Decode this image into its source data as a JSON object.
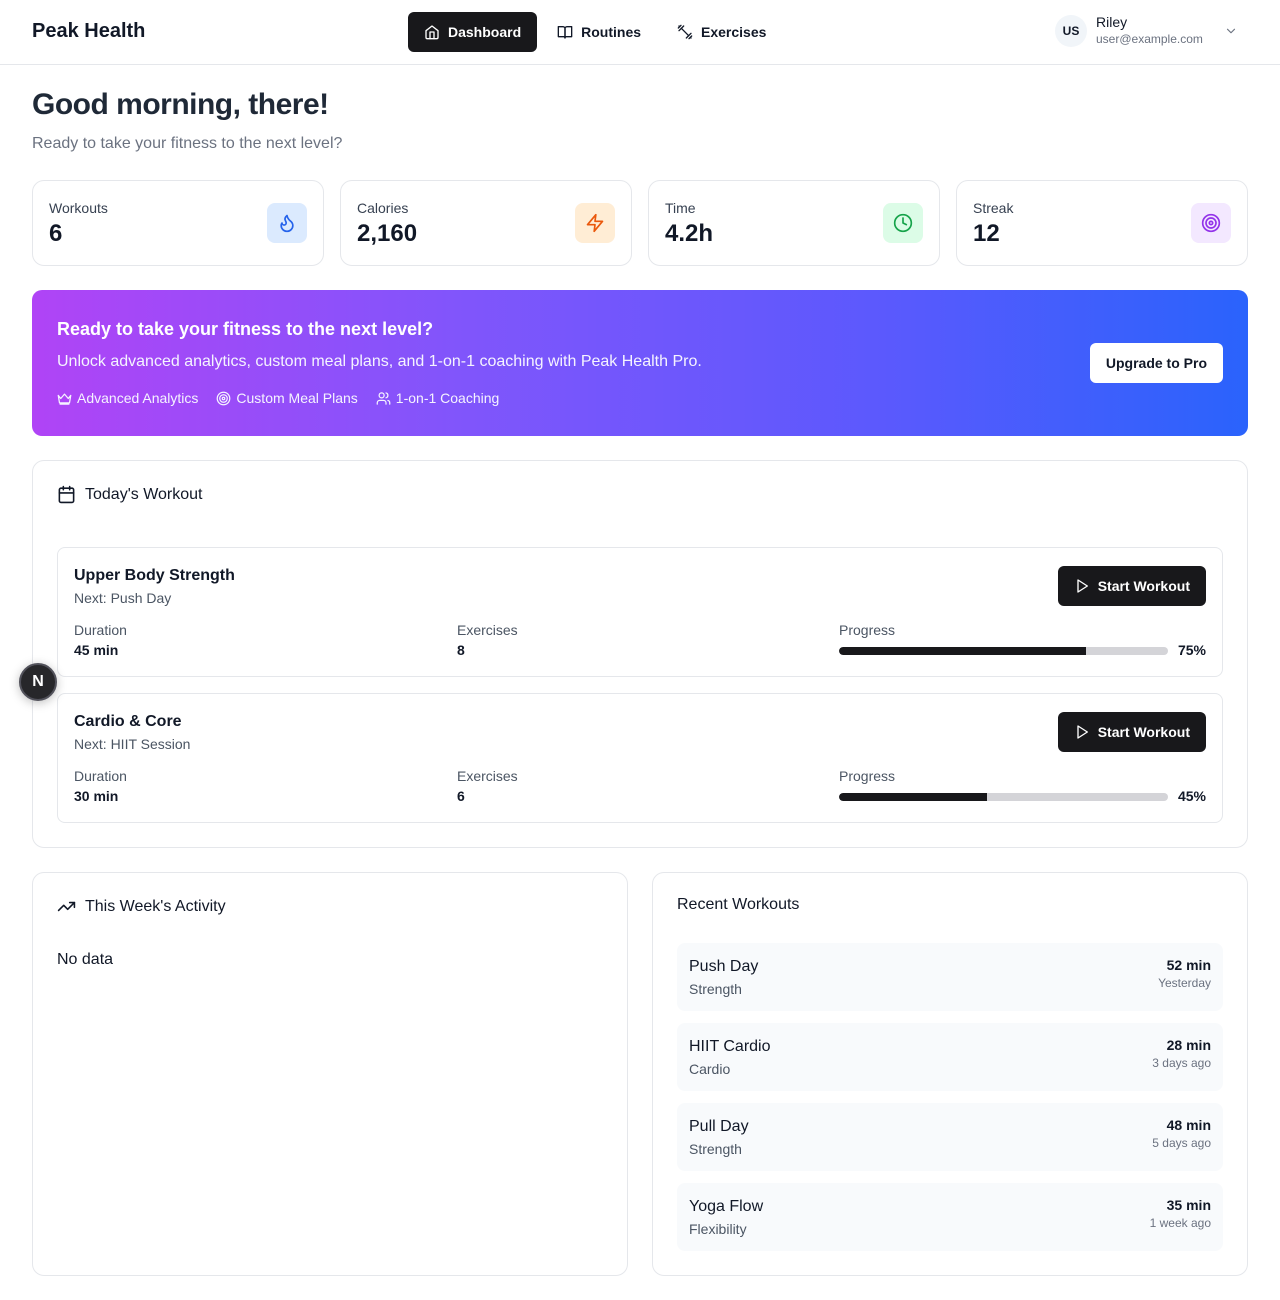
{
  "brand": "Peak Health",
  "nav": [
    {
      "label": "Dashboard",
      "icon": "home-icon",
      "active": true
    },
    {
      "label": "Routines",
      "icon": "book-icon",
      "active": false
    },
    {
      "label": "Exercises",
      "icon": "dumbbell-icon",
      "active": false
    }
  ],
  "user": {
    "initials": "US",
    "name": "Riley",
    "email": "user@example.com"
  },
  "greeting": {
    "title": "Good morning, there!",
    "subtitle": "Ready to take your fitness to the next level?"
  },
  "stats": [
    {
      "label": "Workouts",
      "value": "6",
      "icon": "flame-icon",
      "color": "#2563eb",
      "bg": "#dbeafe"
    },
    {
      "label": "Calories",
      "value": "2,160",
      "icon": "zap-icon",
      "color": "#ea580c",
      "bg": "#ffedd5"
    },
    {
      "label": "Time",
      "value": "4.2h",
      "icon": "clock-icon",
      "color": "#16a34a",
      "bg": "#dcfce7"
    },
    {
      "label": "Streak",
      "value": "12",
      "icon": "target-icon",
      "color": "#9333ea",
      "bg": "#f3e8ff"
    }
  ],
  "promo": {
    "title": "Ready to take your fitness to the next level?",
    "text": "Unlock advanced analytics, custom meal plans, and 1-on-1 coaching with Peak Health Pro.",
    "features": [
      {
        "label": "Advanced Analytics",
        "icon": "crown-icon"
      },
      {
        "label": "Custom Meal Plans",
        "icon": "target-icon"
      },
      {
        "label": "1-on-1 Coaching",
        "icon": "users-icon"
      }
    ],
    "button": "Upgrade to Pro"
  },
  "today": {
    "title": "Today's Workout",
    "duration_label": "Duration",
    "exercises_label": "Exercises",
    "progress_label": "Progress",
    "start_label": "Start Workout",
    "workouts": [
      {
        "name": "Upper Body Strength",
        "next": "Next: Push Day",
        "duration": "45 min",
        "exercises": "8",
        "progress": 75,
        "progress_text": "75%"
      },
      {
        "name": "Cardio & Core",
        "next": "Next: HIIT Session",
        "duration": "30 min",
        "exercises": "6",
        "progress": 45,
        "progress_text": "45%"
      }
    ]
  },
  "floating_badge": "N",
  "activity": {
    "title": "This Week's Activity",
    "empty": "No data"
  },
  "recent": {
    "title": "Recent Workouts",
    "items": [
      {
        "name": "Push Day",
        "type": "Strength",
        "duration": "52 min",
        "when": "Yesterday"
      },
      {
        "name": "HIIT Cardio",
        "type": "Cardio",
        "duration": "28 min",
        "when": "3 days ago"
      },
      {
        "name": "Pull Day",
        "type": "Strength",
        "duration": "48 min",
        "when": "5 days ago"
      },
      {
        "name": "Yoga Flow",
        "type": "Flexibility",
        "duration": "35 min",
        "when": "1 week ago"
      }
    ]
  }
}
